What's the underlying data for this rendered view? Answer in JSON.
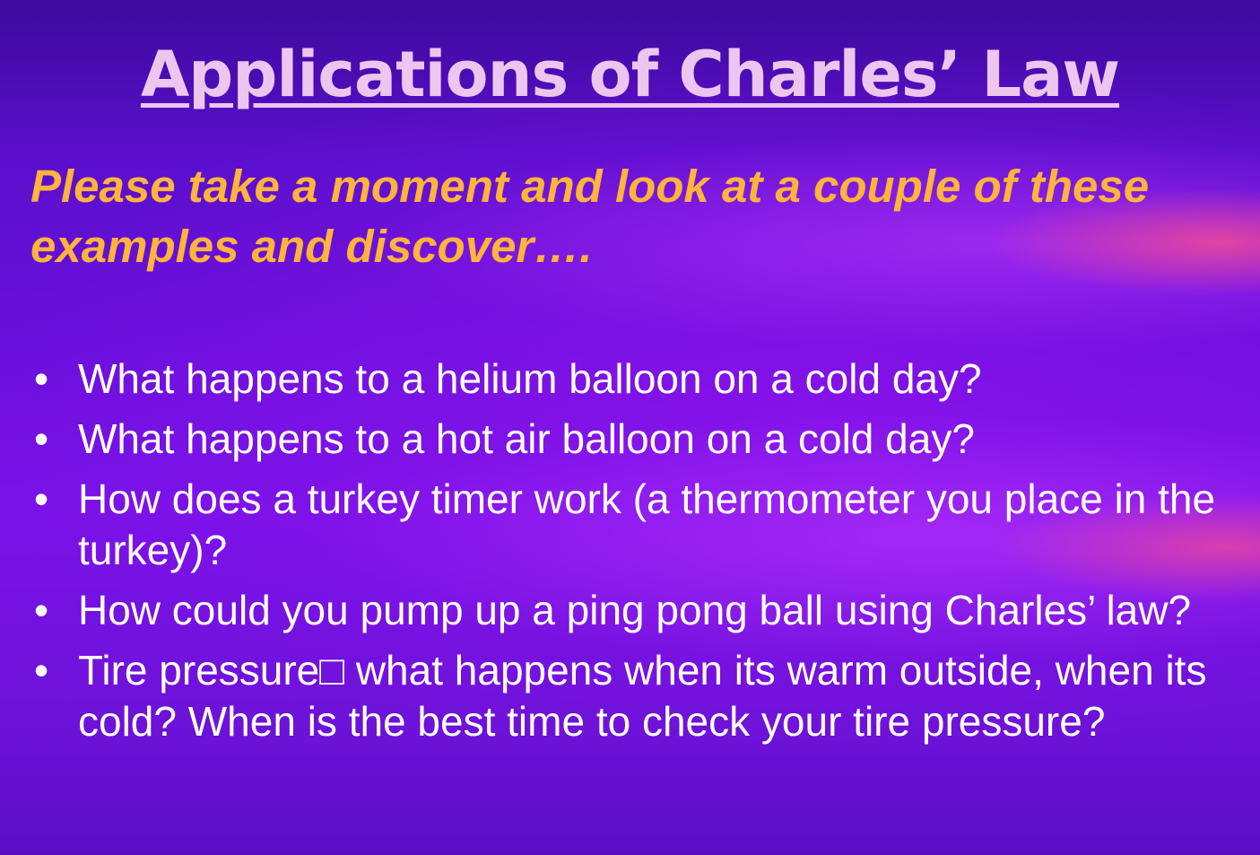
{
  "slide": {
    "title": "Applications of Charles’ Law",
    "subtitle": "Please take a moment and look at a couple of these examples and discover….",
    "bullet_marker": "•",
    "bullets": [
      "What happens to a helium balloon on a cold day?",
      "What happens to a hot air balloon on a cold day?",
      "How does a turkey timer work (a thermometer you place in the turkey)?",
      "How could you pump up a ping pong ball using Charles’ law?",
      "Tire pressure□ what happens when its warm outside, when its cold? When is the best time to check your tire pressure?"
    ]
  },
  "colors": {
    "title": "#ecc6ee",
    "subtitle": "#ffb43c",
    "body_text": "#ffffff",
    "background": "#6a10dc"
  }
}
